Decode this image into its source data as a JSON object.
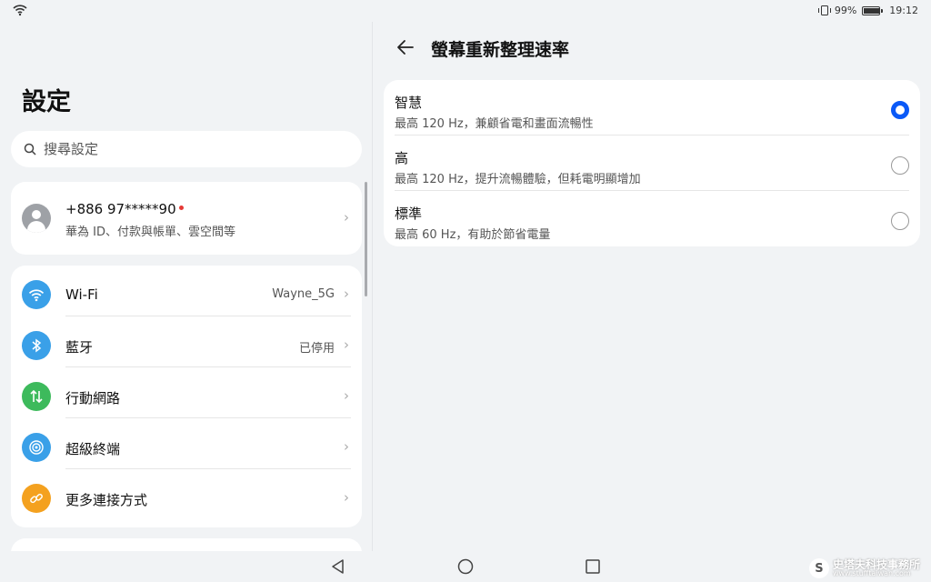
{
  "status_bar": {
    "battery": "99%",
    "battery_level": 0.99,
    "time": "19:12"
  },
  "left": {
    "title": "設定",
    "search_placeholder": "搜尋設定",
    "account": {
      "name": "+886 97*****90",
      "subtitle": "華為 ID、付款與帳單、雲空間等"
    },
    "network_items": [
      {
        "label": "Wi-Fi",
        "value": "Wayne_5G",
        "icon": "wifi-icon",
        "color": "#3aa0e8"
      },
      {
        "label": "藍牙",
        "value": "已停用",
        "icon": "bluetooth-icon",
        "color": "#3aa0e8"
      },
      {
        "label": "行動網路",
        "value": "",
        "icon": "mobile-data-icon",
        "color": "#3dba5c"
      },
      {
        "label": "超級終端",
        "value": "",
        "icon": "super-device-icon",
        "color": "#3aa0e8"
      },
      {
        "label": "更多連接方式",
        "value": "",
        "icon": "link-icon",
        "color": "#f4a11f"
      }
    ]
  },
  "right": {
    "title": "螢幕重新整理速率",
    "options": [
      {
        "title": "智慧",
        "desc": "最高 120 Hz，兼顧省電和畫面流暢性",
        "selected": true
      },
      {
        "title": "高",
        "desc": "最高 120 Hz，提升流暢體驗，但耗電明顯增加",
        "selected": false
      },
      {
        "title": "標準",
        "desc": "最高 60 Hz，有助於節省電量",
        "selected": false
      }
    ]
  },
  "watermark": {
    "title": "史塔夫科技事務所",
    "url": "www.stufftaiwan.com",
    "logo": "S"
  }
}
